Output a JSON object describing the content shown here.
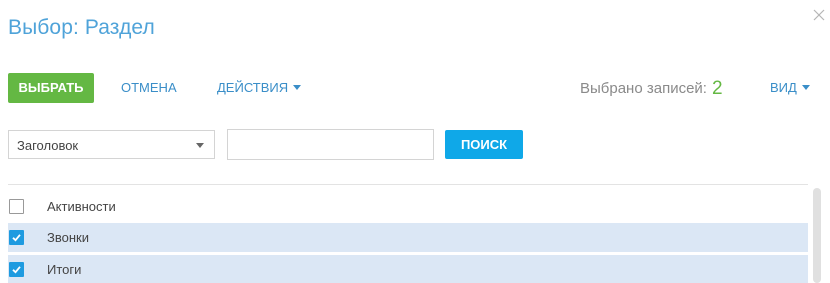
{
  "dialog": {
    "title": "Выбор: Раздел"
  },
  "toolbar": {
    "select_label": "ВЫБРАТЬ",
    "cancel_label": "ОТМЕНА",
    "actions_label": "ДЕЙСТВИЯ",
    "selected_text": "Выбрано записей:",
    "selected_count": "2",
    "view_label": "ВИД"
  },
  "search": {
    "column_value": "Заголовок",
    "input_value": "",
    "button_label": "ПОИСК"
  },
  "list": {
    "items": [
      {
        "label": "Активности",
        "checked": false
      },
      {
        "label": "Звонки",
        "checked": true
      },
      {
        "label": "Итоги",
        "checked": true
      }
    ]
  },
  "colors": {
    "title": "#4fa3d9",
    "primary_button": "#64b843",
    "search_button": "#0fa8e8",
    "selected_row": "#dbe7f5",
    "checkbox_checked": "#1e9be0",
    "count_green": "#64b843"
  },
  "icons": {
    "close": "close-icon",
    "actions_caret": "caret-down-icon",
    "view_caret": "caret-down-icon",
    "select_caret": "chevron-down-icon",
    "check": "checkmark-icon"
  }
}
